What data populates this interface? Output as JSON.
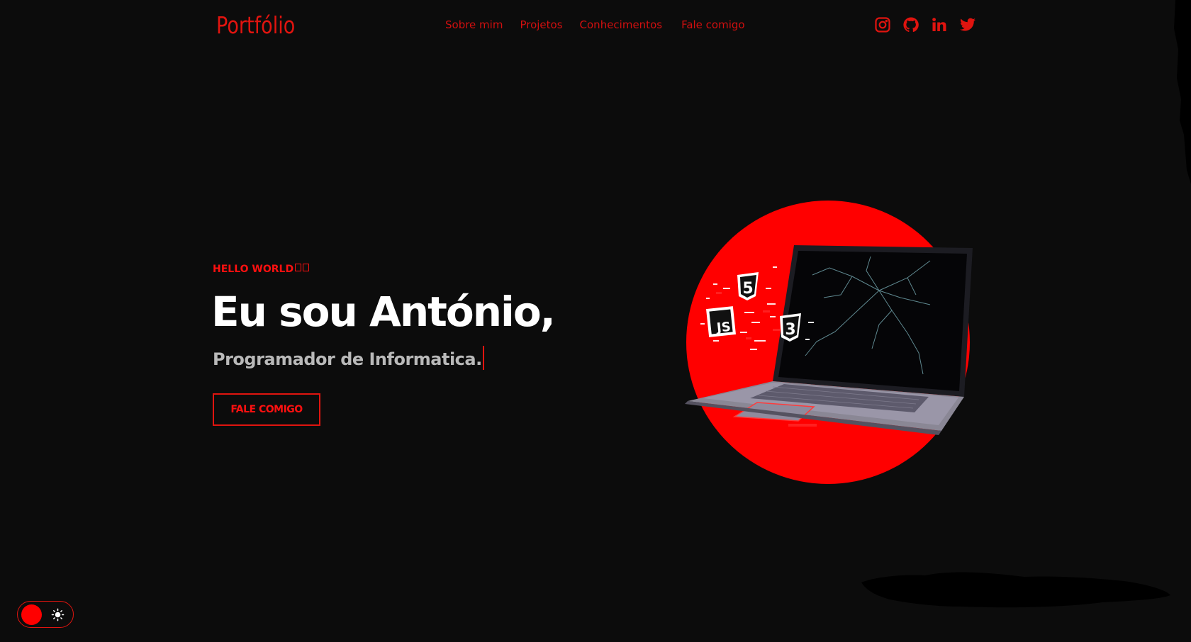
{
  "header": {
    "logo": "Portfólio",
    "nav": [
      {
        "label": "Sobre mim"
      },
      {
        "label": "Projetos"
      },
      {
        "label": "Conhecimentos"
      },
      {
        "label": "Fale comigo"
      }
    ],
    "socials": [
      "instagram-icon",
      "github-icon",
      "linkedin-icon",
      "twitter-icon"
    ]
  },
  "hero": {
    "greeting": "HELLO WORLD",
    "title": "Eu sou António,",
    "subtitle": "Programador de Informatica.",
    "cta_label": "FALE COMIGO",
    "image_labels": {
      "html": "5",
      "js": "JS",
      "css": "3"
    }
  },
  "theme_toggle": {
    "icon": "sun-icon"
  },
  "colors": {
    "background": "#0c0c0c",
    "accent": "#ff0000",
    "nav": "#d10f0f",
    "title": "#ffffff",
    "subtitle": "#b9b9b9"
  }
}
